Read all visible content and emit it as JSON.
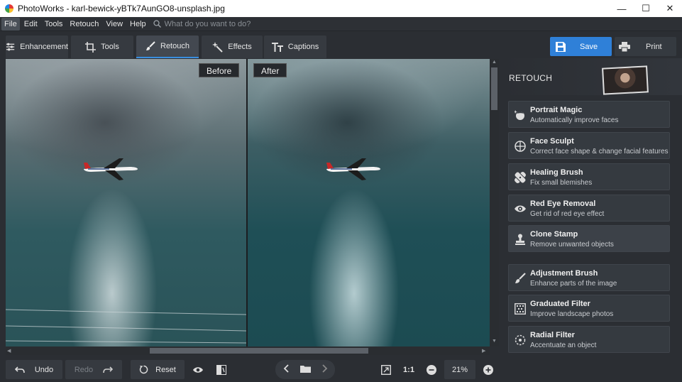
{
  "window": {
    "title": "PhotoWorks - karl-bewick-yBTk7AunGO8-unsplash.jpg",
    "controls": [
      "—",
      "☐",
      "✕"
    ]
  },
  "menu": {
    "items": [
      "File",
      "Edit",
      "Tools",
      "Retouch",
      "View",
      "Help"
    ],
    "active": "File",
    "search_placeholder": "What do you want to do?"
  },
  "tabs": [
    {
      "label": "Enhancement",
      "icon": "sliders-icon"
    },
    {
      "label": "Tools",
      "icon": "crop-icon"
    },
    {
      "label": "Retouch",
      "icon": "brush-icon",
      "active": true
    },
    {
      "label": "Effects",
      "icon": "magic-wand-icon"
    },
    {
      "label": "Captions",
      "icon": "text-icon"
    }
  ],
  "actions": {
    "save": "Save",
    "print": "Print"
  },
  "viewer": {
    "before_label": "Before",
    "after_label": "After"
  },
  "bottom": {
    "undo": "Undo",
    "redo": "Redo",
    "reset": "Reset",
    "one_to_one": "1:1",
    "zoom": "21%"
  },
  "panel": {
    "title": "RETOUCH",
    "tools": [
      {
        "title": "Portrait Magic",
        "desc": "Automatically improve faces",
        "icon": "portrait-magic-icon"
      },
      {
        "title": "Face Sculpt",
        "desc": "Correct face shape & change facial features",
        "icon": "face-sculpt-icon"
      },
      {
        "title": "Healing Brush",
        "desc": "Fix small blemishes",
        "icon": "bandage-icon"
      },
      {
        "title": "Red Eye Removal",
        "desc": "Get rid of red eye effect",
        "icon": "eye-icon"
      },
      {
        "title": "Clone Stamp",
        "desc": "Remove unwanted objects",
        "icon": "stamp-icon"
      },
      {
        "title": "Adjustment Brush",
        "desc": "Enhance parts of the image",
        "icon": "brush-icon"
      },
      {
        "title": "Graduated Filter",
        "desc": "Improve landscape photos",
        "icon": "gradient-icon"
      },
      {
        "title": "Radial Filter",
        "desc": "Accentuate an object",
        "icon": "radial-icon"
      }
    ]
  },
  "colors": {
    "accent": "#2f80d8",
    "background": "#2b2e33",
    "card": "#353a40"
  }
}
